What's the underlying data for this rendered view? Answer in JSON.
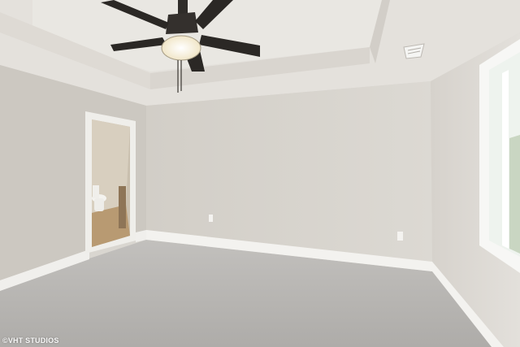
{
  "photo": {
    "subject": "empty-bedroom-interior",
    "watermark": "©VHT STUDIOS"
  },
  "colors": {
    "ceiling": "#e6e3de",
    "ceiling_shadow": "#d4d0ca",
    "back_wall": "#d8d4cd",
    "left_wall": "#cfcbc4",
    "right_wall": "#dcd8d2",
    "baseboard": "#f2f1ee",
    "carpet": "#b5b3b0",
    "trim": "#eeede9",
    "fan_blade": "#2e2b28",
    "fan_light": "#f7f0dc",
    "floor_wood": "#b89a72"
  }
}
